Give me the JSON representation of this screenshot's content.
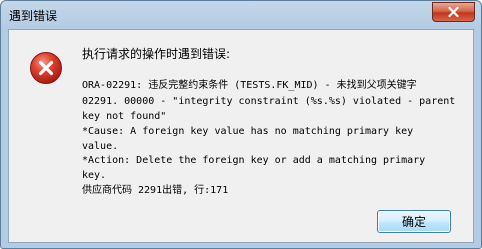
{
  "window": {
    "title": "遇到错误",
    "close_icon": "close-icon"
  },
  "dialog": {
    "icon": "error-icon",
    "heading": "执行请求的操作时遇到错误:",
    "message_lines": [
      "ORA-02291: 违反完整约束条件 (TESTS.FK_MID) - 未找到父项关键字",
      "02291. 00000 - \"integrity constraint (%s.%s) violated - parent",
      "key not found\"",
      "*Cause:    A foreign key value has no matching primary key",
      "value.",
      "*Action:   Delete the foreign key or add a matching primary",
      "key.",
      "供应商代码 2291出错, 行:171"
    ],
    "ok_label": "确定"
  },
  "colors": {
    "frame": "#b3cbe3",
    "client": "#f0f0f0",
    "close": "#c1361b",
    "error": "#d8342a"
  }
}
